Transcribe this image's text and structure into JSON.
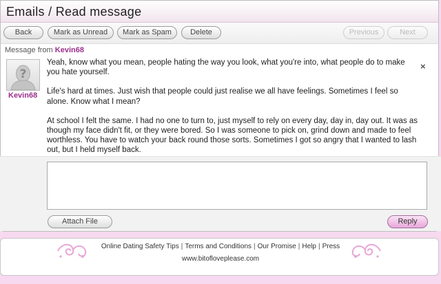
{
  "header": {
    "title": "Emails / Read message"
  },
  "toolbar": {
    "back": "Back",
    "mark_unread": "Mark as Unread",
    "mark_spam": "Mark as Spam",
    "delete": "Delete",
    "previous": "Previous",
    "next": "Next"
  },
  "message": {
    "from_label": "Message from",
    "sender": "Kevin68",
    "paragraphs": [
      "Yeah, know what you mean, people hating the way you look, what you're into, what people do to make you hate yourself.",
      "Life's hard at times. Just wish that people could just realise we all have feelings. Sometimes I feel so alone. Know what I mean?",
      "At school I felt the same. I had no one to turn to, just myself to rely on every day, day in, day out. It was as though my face didn't fit, or they were bored. So I was someone to pick on, grind down and made to feel worthless. You have to watch your back round those sorts. Sometimes I got so angry that I wanted to lash out, but I held myself back."
    ],
    "close_glyph": "×"
  },
  "reply": {
    "input_value": "",
    "attach_label": "Attach File",
    "reply_label": "Reply"
  },
  "footer": {
    "links": [
      "Online Dating Safety Tips",
      "Terms and Conditions",
      "Our Promise",
      "Help",
      "Press"
    ],
    "separator": "|",
    "url": "www.bitofloveplease.com"
  },
  "colors": {
    "background": "#f7d9f0",
    "accent": "#9b2f8c",
    "reply_button": "#e8a6d9",
    "swirl": "#e9a6d6"
  },
  "icons": {
    "avatar": "silhouette-question-icon",
    "close": "close-icon",
    "decoration": "swirl-ornament-icon"
  }
}
